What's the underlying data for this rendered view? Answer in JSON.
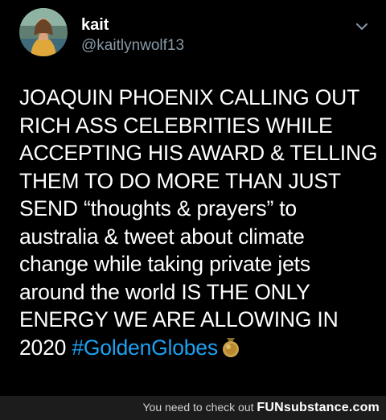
{
  "tweet": {
    "display_name": "kait",
    "handle": "@kaitlynwolf13",
    "menu_icon": "chevron-down-icon",
    "avatar_icon": "avatar-photo",
    "text_lines": [
      "JOAQUIN PHOENIX CALLING OUT",
      "RICH ASS CELEBRITIES WHILE",
      "ACCEPTING HIS AWARD & TELLING",
      "THEM TO DO MORE THAN JUST",
      "SEND “thoughts & prayers” to",
      "australia & tweet about climate",
      "change while taking private jets",
      "around the world IS THE ONLY",
      "ENERGY WE ARE ALLOWING IN"
    ],
    "last_line_prefix": "2020 ",
    "hashtag": "#GoldenGlobes",
    "emoji_icon": "gold-medal-emoji-icon",
    "colors": {
      "background": "#000000",
      "text": "#ffffff",
      "handle": "#8899a6",
      "hashtag": "#1da1f2"
    }
  },
  "watermark": {
    "text": "You need to check out",
    "brand": "FUNsubstance.com"
  }
}
